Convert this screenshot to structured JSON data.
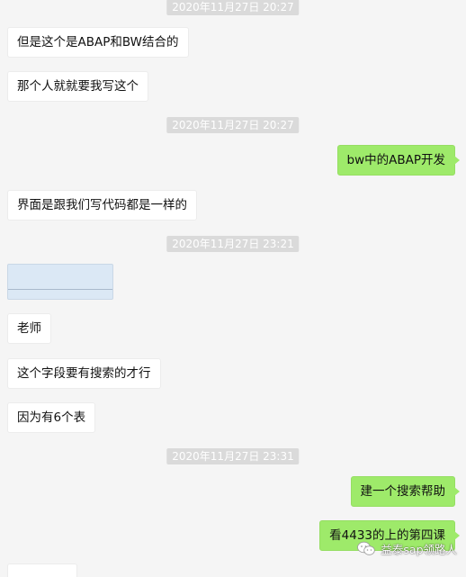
{
  "messages": [
    {
      "kind": "timestamp",
      "text": "2020年11月27日 20:27"
    },
    {
      "kind": "text",
      "side": "left",
      "text": "但是这个是ABAP和BW结合的"
    },
    {
      "kind": "text",
      "side": "left",
      "text": "那个人就就要我写这个"
    },
    {
      "kind": "timestamp",
      "text": "2020年11月27日 20:27"
    },
    {
      "kind": "text",
      "side": "right",
      "text": "bw中的ABAP开发"
    },
    {
      "kind": "text",
      "side": "left",
      "text": "界面是跟我们写代码都是一样的"
    },
    {
      "kind": "timestamp",
      "text": "2020年11月27日 23:21"
    },
    {
      "kind": "image",
      "side": "left"
    },
    {
      "kind": "text",
      "side": "left",
      "text": "老师"
    },
    {
      "kind": "text",
      "side": "left",
      "text": "这个字段要有搜索的才行"
    },
    {
      "kind": "text",
      "side": "left",
      "text": "因为有6个表"
    },
    {
      "kind": "timestamp",
      "text": "2020年11月27日 23:31"
    },
    {
      "kind": "text",
      "side": "right",
      "text": "建一个搜索帮助"
    },
    {
      "kind": "text",
      "side": "right",
      "text": "看4433的上的第四课"
    }
  ],
  "watermark": {
    "icon": "wechat-icon",
    "text": "益泰sap领路人"
  },
  "colors": {
    "background": "#f5f5f5",
    "incoming_bubble": "#ffffff",
    "outgoing_bubble": "#9eea6a",
    "timestamp_bg": "#dadada"
  }
}
